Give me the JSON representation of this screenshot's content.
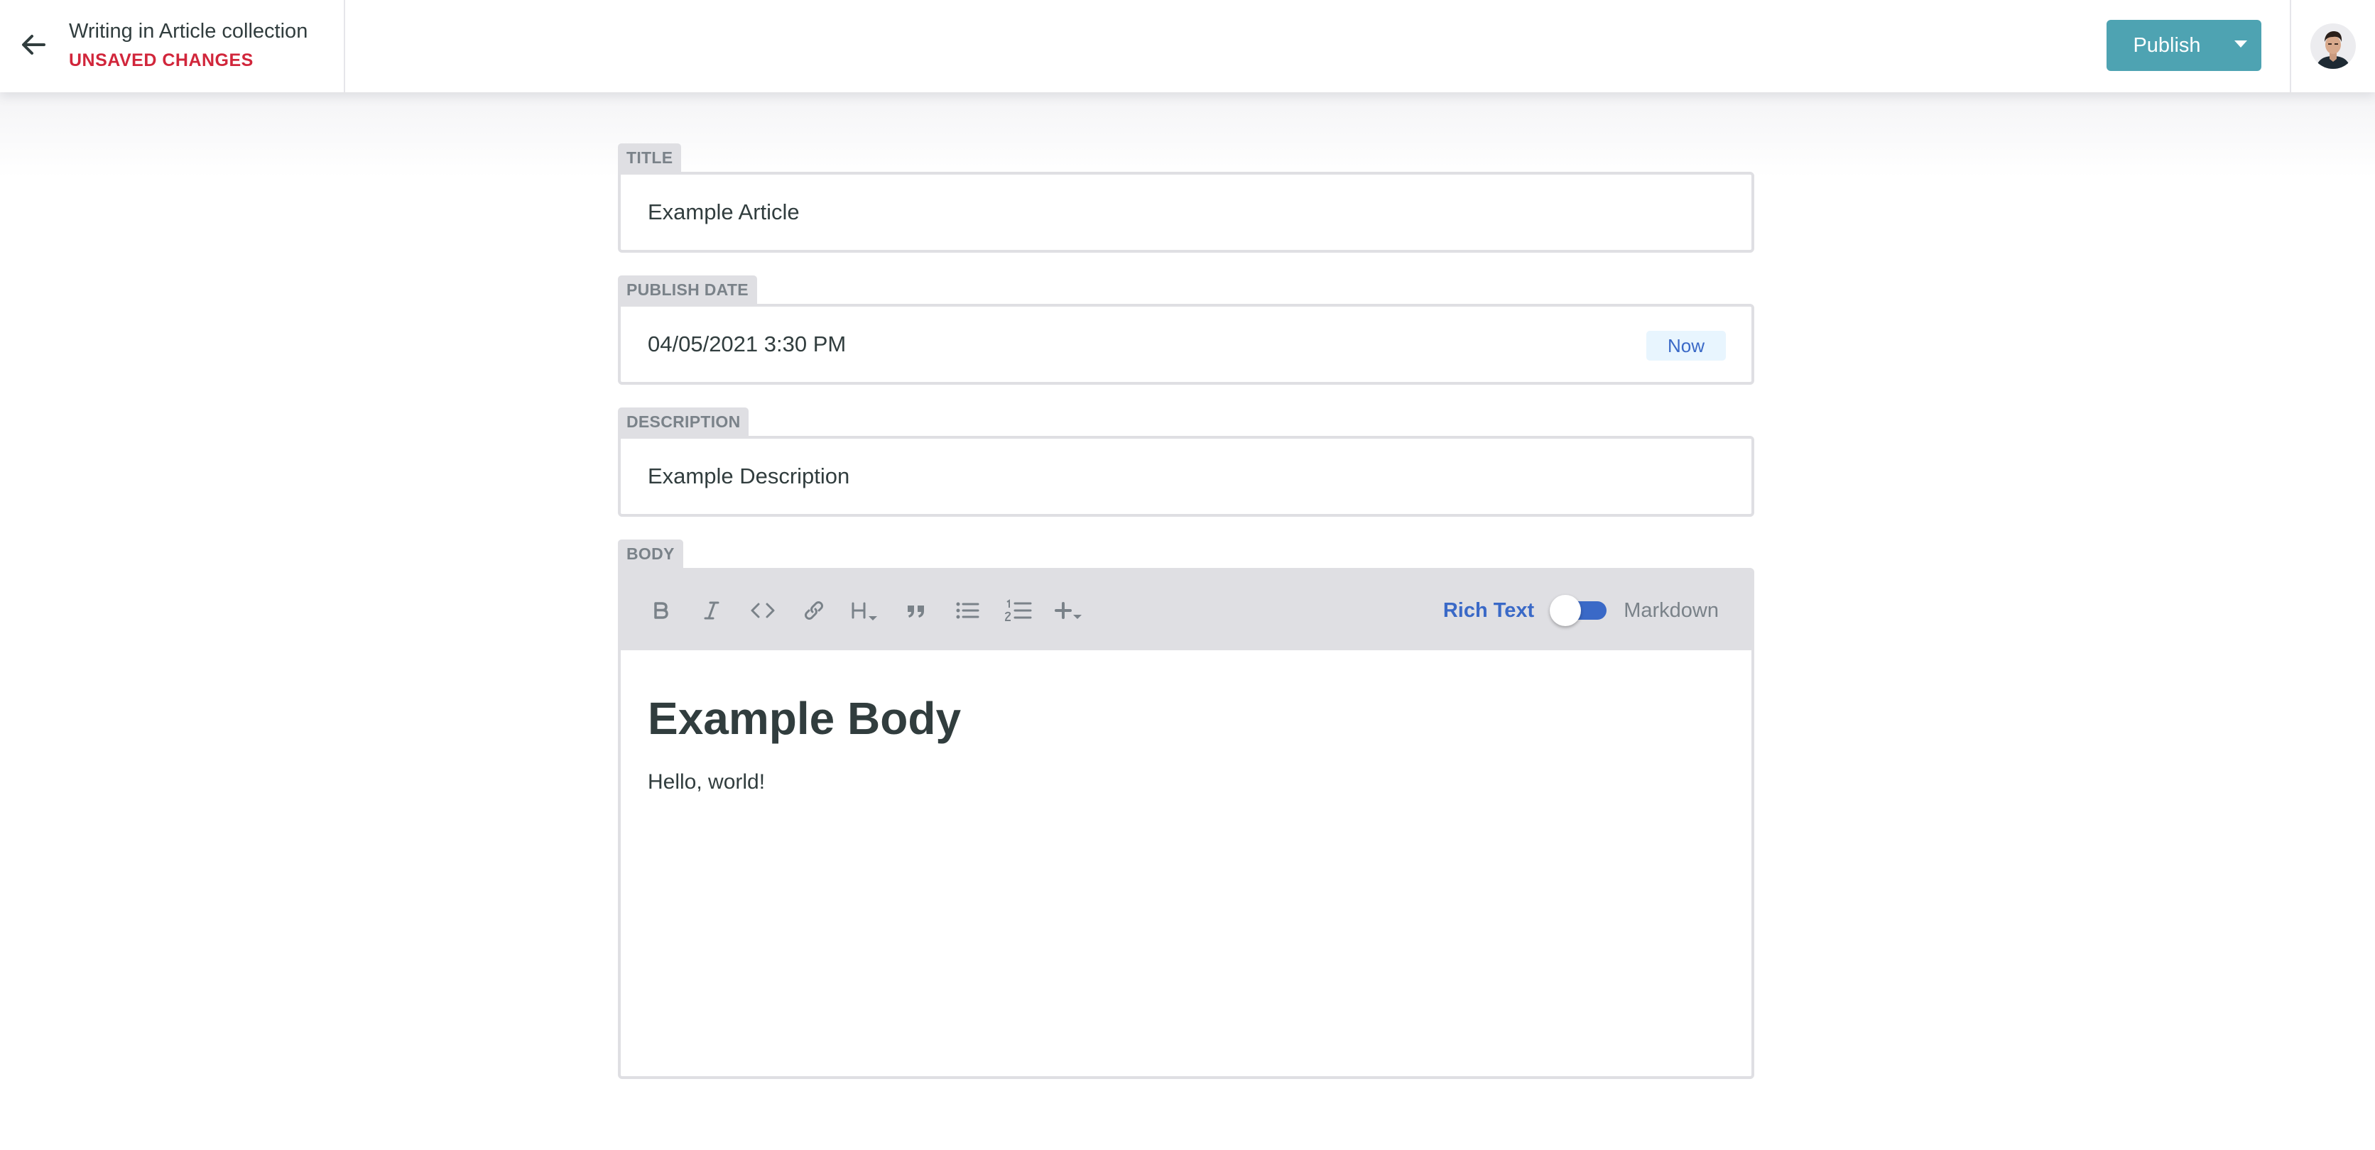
{
  "header": {
    "back_icon": "arrow-left-icon",
    "title": "Writing in Article collection",
    "status": "UNSAVED CHANGES",
    "status_color": "#d1263b",
    "publish_label": "Publish",
    "publish_color": "#4ea3b2",
    "publish_menu_icon": "caret-down-icon",
    "avatar_icon": "user-avatar"
  },
  "fields": {
    "title": {
      "label": "TITLE",
      "value": "Example Article"
    },
    "publish_date": {
      "label": "PUBLISH DATE",
      "value": "04/05/2021 3:30 PM",
      "now_label": "Now"
    },
    "description": {
      "label": "DESCRIPTION",
      "value": "Example Description"
    },
    "body": {
      "label": "BODY",
      "toolbar": [
        "bold-icon",
        "italic-icon",
        "code-icon",
        "link-icon",
        "heading-icon",
        "quote-icon",
        "bulleted-list-icon",
        "numbered-list-icon",
        "add-icon"
      ],
      "mode_rich_text": "Rich Text",
      "mode_markdown": "Markdown",
      "mode_selected": "Rich Text",
      "accent_color": "#3a69c7",
      "heading": "Example Body",
      "paragraph": "Hello, world!"
    }
  }
}
